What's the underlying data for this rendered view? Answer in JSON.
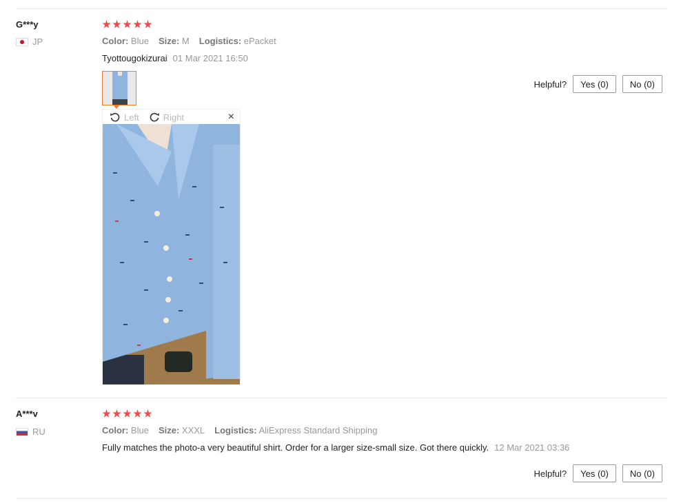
{
  "reviews": [
    {
      "user": "G***y",
      "country": "JP",
      "rating": 5,
      "attributes": [
        {
          "key": "Color:",
          "value": "Blue"
        },
        {
          "key": "Size:",
          "value": "M"
        },
        {
          "key": "Logistics:",
          "value": "ePacket"
        }
      ],
      "text": "Tyottougokizurai",
      "date": "01 Mar 2021 16:50",
      "helpful_label": "Helpful?",
      "yes_label": "Yes (0)",
      "no_label": "No (0)",
      "viewer": {
        "rotate_left_label": "Left",
        "rotate_right_label": "Right",
        "close_symbol": "×"
      }
    },
    {
      "user": "A***v",
      "country": "RU",
      "rating": 5,
      "attributes": [
        {
          "key": "Color:",
          "value": "Blue"
        },
        {
          "key": "Size:",
          "value": "XXXL"
        },
        {
          "key": "Logistics:",
          "value": "AliExpress Standard Shipping"
        }
      ],
      "text": "Fully matches the photo-a very beautiful shirt. Order for a larger size-small size. Got there quickly.",
      "date": "12 Mar 2021 03:36",
      "helpful_label": "Helpful?",
      "yes_label": "Yes (0)",
      "no_label": "No (0)"
    }
  ],
  "colors": {
    "star": "#f04a4a",
    "thumb_border": "#f07c2e",
    "shirt": "#8fb5de"
  }
}
